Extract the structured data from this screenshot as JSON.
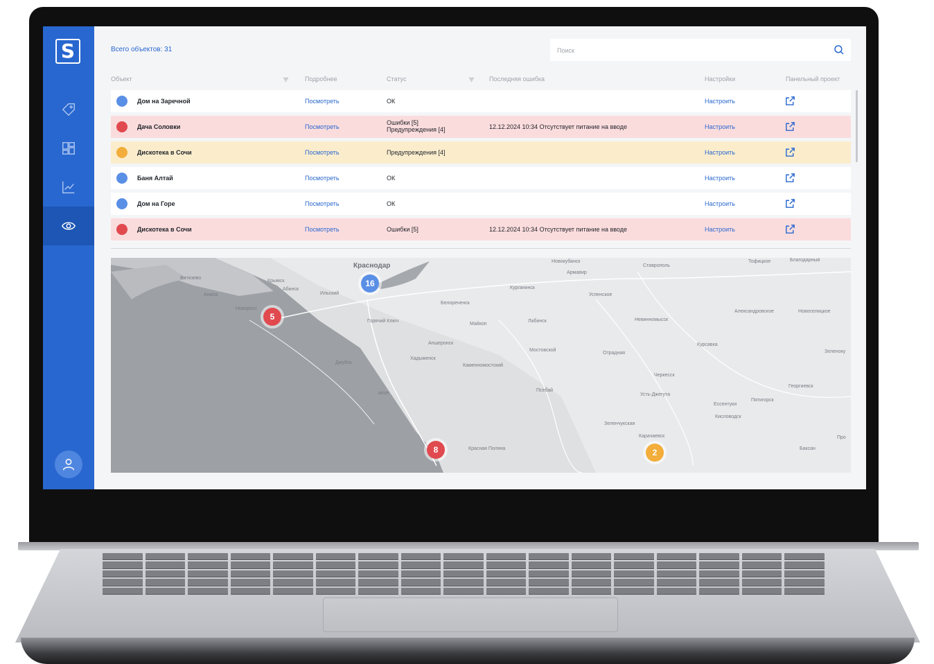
{
  "app": {
    "logo_text": "S",
    "nav": [
      {
        "icon": "tag-icon",
        "active": false
      },
      {
        "icon": "dashboard-icon",
        "active": false
      },
      {
        "icon": "chart-icon",
        "active": false
      },
      {
        "icon": "eye-icon",
        "active": true
      }
    ],
    "profile_icon": "user-icon",
    "accent_color": "#2867cf"
  },
  "header": {
    "total_label": "Всего объектов: 31",
    "search_placeholder": "Поиск"
  },
  "table": {
    "columns": {
      "object": "Объект",
      "details": "Подробнее",
      "status": "Статус",
      "last_error": "Последняя ошибка",
      "settings": "Настройки",
      "panel_project": "Панельный проект"
    },
    "rows": [
      {
        "name": "Дом на Заречной",
        "details": "Посмотреть",
        "status": "ОК",
        "last_error": "",
        "settings": "Настроить",
        "state": "ok"
      },
      {
        "name": "Дача Соловки",
        "details": "Посмотреть",
        "status": "Ошибки [5]\nПредупреждения [4]",
        "last_error": "12.12.2024 10:34 Отсутствует питание на вводе",
        "settings": "Настроить",
        "state": "error"
      },
      {
        "name": "Дискотека в Сочи",
        "details": "Посмотреть",
        "status": "Предупреждения [4]",
        "last_error": "",
        "settings": "Настроить",
        "state": "warning"
      },
      {
        "name": "Баня Алтай",
        "details": "Посмотреть",
        "status": "ОК",
        "last_error": "",
        "settings": "Настроить",
        "state": "ok"
      },
      {
        "name": "Дом на Горе",
        "details": "Посмотреть",
        "status": "ОК",
        "last_error": "",
        "settings": "Настроить",
        "state": "ok"
      },
      {
        "name": "Дискотека в Сочи",
        "details": "Посмотреть",
        "status": "Ошибки [5]",
        "last_error": "12.12.2024 10:34 Отсутствует питание на вводе",
        "settings": "Настроить",
        "state": "error"
      }
    ],
    "state_colors": {
      "ok": "#5a8fe6",
      "error": "#e04a4f",
      "warning": "#f3ad3a"
    }
  },
  "map": {
    "clusters": [
      {
        "count": "16",
        "color": "blue"
      },
      {
        "count": "5",
        "color": "red"
      },
      {
        "count": "8",
        "color": "red"
      },
      {
        "count": "2",
        "color": "orange"
      }
    ],
    "places": {
      "krasnodar": "Краснодар",
      "stavropol": "Ставрополь",
      "armavir": "Армавир",
      "kurganinsk": "Курганинск",
      "uspenskoe": "Успенское",
      "krymsk": "Крымск",
      "abinsk": "Абинск",
      "ilsky": "Ильский",
      "belorechensk": "Белореченск",
      "goryachy_klyuch": "Горячий Ключ",
      "maykop": "Майкоп",
      "labinsk": "Лабинск",
      "nevinnomyssk": "Невинномысск",
      "aleksandrovskoe": "Александровское",
      "novoseletskoe": "Новоселицкое",
      "kursavka": "Курсавка",
      "zelenokumsk": "Зеленоку",
      "apsheronsk": "Апшеронск",
      "khadyzhensk": "Хадыженск",
      "dzhubga": "Джубга",
      "kamennomostsky": "Каменномостский",
      "mostovskoy": "Мостовской",
      "otradnaya": "Отрадная",
      "cherkessk": "Черкесск",
      "georgievsk": "Георгиевск",
      "pyatigorsk": "Пятигорск",
      "essentuki": "Ессентуки",
      "kislovodsk": "Кисловодск",
      "psebay": "Псебай",
      "ust_dzheguta": "Усть-Джегута",
      "zelenchukskaya": "Зеленчукская",
      "karachaevsk": "Карачаевск",
      "krasnaya_polyana": "Красная Поляна",
      "baksan": "Баксан",
      "novorossiysk": "Новоросс",
      "anapa": "Анапа",
      "vityazevo": "Витязево",
      "tuapse": "апсе",
      "novokubansk": "Новокубанск",
      "tsifuoe": "Тофицкое",
      "blagodarny": "Благодарный",
      "pro": "Про"
    }
  }
}
